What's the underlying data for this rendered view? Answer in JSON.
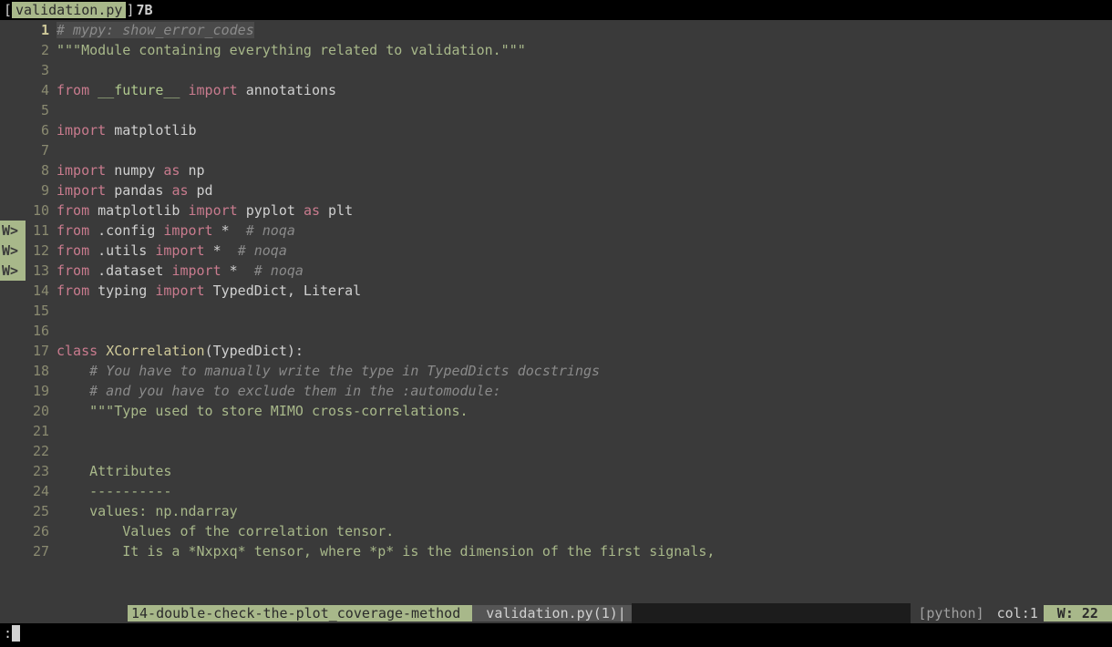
{
  "tab": {
    "open": "[",
    "name": "validation.py ",
    "close": "]",
    "suffix": "7B"
  },
  "lines": [
    {
      "n": "1",
      "sign": "",
      "current": true,
      "tokens": [
        {
          "cls": "comment comment-bg",
          "t": "# mypy: show_error_codes"
        }
      ]
    },
    {
      "n": "2",
      "sign": "",
      "tokens": [
        {
          "cls": "string",
          "t": "\"\"\"Module containing everything related to validation.\"\"\""
        }
      ]
    },
    {
      "n": "3",
      "sign": "",
      "tokens": [
        {
          "cls": "",
          "t": ""
        }
      ]
    },
    {
      "n": "4",
      "sign": "",
      "tokens": [
        {
          "cls": "keyword",
          "t": "from "
        },
        {
          "cls": "builtin",
          "t": "__future__"
        },
        {
          "cls": "keyword",
          "t": " import "
        },
        {
          "cls": "ident",
          "t": "annotations"
        }
      ]
    },
    {
      "n": "5",
      "sign": "",
      "tokens": [
        {
          "cls": "",
          "t": ""
        }
      ]
    },
    {
      "n": "6",
      "sign": "",
      "tokens": [
        {
          "cls": "keyword",
          "t": "import "
        },
        {
          "cls": "ident",
          "t": "matplotlib"
        }
      ]
    },
    {
      "n": "7",
      "sign": "",
      "tokens": [
        {
          "cls": "",
          "t": ""
        }
      ]
    },
    {
      "n": "8",
      "sign": "",
      "tokens": [
        {
          "cls": "keyword",
          "t": "import "
        },
        {
          "cls": "ident",
          "t": "numpy "
        },
        {
          "cls": "keyword",
          "t": "as "
        },
        {
          "cls": "ident",
          "t": "np"
        }
      ]
    },
    {
      "n": "9",
      "sign": "",
      "tokens": [
        {
          "cls": "keyword",
          "t": "import "
        },
        {
          "cls": "ident",
          "t": "pandas "
        },
        {
          "cls": "keyword",
          "t": "as "
        },
        {
          "cls": "ident",
          "t": "pd"
        }
      ]
    },
    {
      "n": "10",
      "sign": "",
      "tokens": [
        {
          "cls": "keyword",
          "t": "from "
        },
        {
          "cls": "ident",
          "t": "matplotlib "
        },
        {
          "cls": "keyword",
          "t": "import "
        },
        {
          "cls": "ident",
          "t": "pyplot "
        },
        {
          "cls": "keyword",
          "t": "as "
        },
        {
          "cls": "ident",
          "t": "plt"
        }
      ]
    },
    {
      "n": "11",
      "sign": "W>",
      "tokens": [
        {
          "cls": "keyword",
          "t": "from "
        },
        {
          "cls": "ident",
          "t": ".config "
        },
        {
          "cls": "keyword",
          "t": "import "
        },
        {
          "cls": "op",
          "t": "*  "
        },
        {
          "cls": "comment",
          "t": "# noqa"
        }
      ]
    },
    {
      "n": "12",
      "sign": "W>",
      "tokens": [
        {
          "cls": "keyword",
          "t": "from "
        },
        {
          "cls": "ident",
          "t": ".utils "
        },
        {
          "cls": "keyword",
          "t": "import "
        },
        {
          "cls": "op",
          "t": "*  "
        },
        {
          "cls": "comment",
          "t": "# noqa"
        }
      ]
    },
    {
      "n": "13",
      "sign": "W>",
      "tokens": [
        {
          "cls": "keyword",
          "t": "from "
        },
        {
          "cls": "ident",
          "t": ".dataset "
        },
        {
          "cls": "keyword",
          "t": "import "
        },
        {
          "cls": "op",
          "t": "*  "
        },
        {
          "cls": "comment",
          "t": "# noqa"
        }
      ]
    },
    {
      "n": "14",
      "sign": "",
      "tokens": [
        {
          "cls": "keyword",
          "t": "from "
        },
        {
          "cls": "ident",
          "t": "typing "
        },
        {
          "cls": "keyword",
          "t": "import "
        },
        {
          "cls": "ident",
          "t": "TypedDict, Literal"
        }
      ]
    },
    {
      "n": "15",
      "sign": "",
      "tokens": [
        {
          "cls": "",
          "t": ""
        }
      ]
    },
    {
      "n": "16",
      "sign": "",
      "tokens": [
        {
          "cls": "",
          "t": ""
        }
      ]
    },
    {
      "n": "17",
      "sign": "",
      "tokens": [
        {
          "cls": "keyword",
          "t": "class "
        },
        {
          "cls": "type",
          "t": "XCorrelation"
        },
        {
          "cls": "op",
          "t": "("
        },
        {
          "cls": "ident",
          "t": "TypedDict"
        },
        {
          "cls": "op",
          "t": "):"
        }
      ]
    },
    {
      "n": "18",
      "sign": "",
      "tokens": [
        {
          "cls": "",
          "t": "    "
        },
        {
          "cls": "comment",
          "t": "# You have to manually write the type in TypedDicts docstrings"
        }
      ]
    },
    {
      "n": "19",
      "sign": "",
      "tokens": [
        {
          "cls": "",
          "t": "    "
        },
        {
          "cls": "comment",
          "t": "# and you have to exclude them in the :automodule:"
        }
      ]
    },
    {
      "n": "20",
      "sign": "",
      "tokens": [
        {
          "cls": "",
          "t": "    "
        },
        {
          "cls": "string",
          "t": "\"\"\"Type used to store MIMO cross-correlations."
        }
      ]
    },
    {
      "n": "21",
      "sign": "",
      "tokens": [
        {
          "cls": "",
          "t": ""
        }
      ]
    },
    {
      "n": "22",
      "sign": "",
      "tokens": [
        {
          "cls": "",
          "t": ""
        }
      ]
    },
    {
      "n": "23",
      "sign": "",
      "tokens": [
        {
          "cls": "string",
          "t": "    Attributes"
        }
      ]
    },
    {
      "n": "24",
      "sign": "",
      "tokens": [
        {
          "cls": "string",
          "t": "    ----------"
        }
      ]
    },
    {
      "n": "25",
      "sign": "",
      "tokens": [
        {
          "cls": "string",
          "t": "    values: np.ndarray"
        }
      ]
    },
    {
      "n": "26",
      "sign": "",
      "tokens": [
        {
          "cls": "string",
          "t": "        Values of the correlation tensor."
        }
      ]
    },
    {
      "n": "27",
      "sign": "",
      "tokens": [
        {
          "cls": "string",
          "t": "        It is a *Nxpxq* tensor, where *p* is the dimension of the first signals,"
        }
      ]
    }
  ],
  "status": {
    "branch": "14-double-check-the-plot_coverage-method ",
    "file": " validation.py(1)|",
    "ftype": "[python]",
    "col": "col:1",
    "warn": " W: 22 "
  },
  "cmd": {
    "prompt": ":"
  }
}
